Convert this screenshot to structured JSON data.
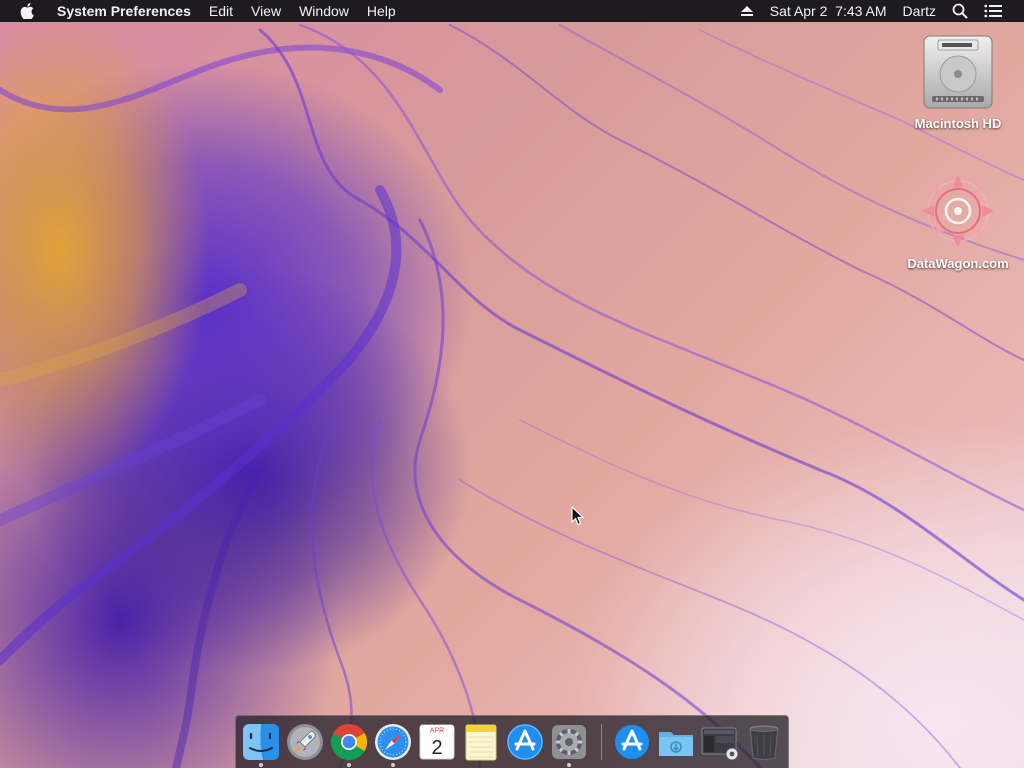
{
  "menubar": {
    "app_name": "System Preferences",
    "menus": [
      "Edit",
      "View",
      "Window",
      "Help"
    ],
    "clock": "Sat Apr 2  7:43 AM",
    "user": "Dartz"
  },
  "desktop": {
    "icons": [
      {
        "label": "Macintosh HD",
        "icon": "hard-drive-icon"
      },
      {
        "label": "DataWagon.com",
        "icon": "datawagon-disk-icon"
      }
    ]
  },
  "dock": {
    "items": [
      {
        "name": "Finder",
        "icon": "finder-icon",
        "running": true
      },
      {
        "name": "Launchpad",
        "icon": "launchpad-icon",
        "running": false
      },
      {
        "name": "Google Chrome",
        "icon": "chrome-icon",
        "running": true
      },
      {
        "name": "Safari",
        "icon": "safari-icon",
        "running": true
      },
      {
        "name": "Calendar",
        "icon": "calendar-icon",
        "running": false,
        "month": "APR",
        "day": "2"
      },
      {
        "name": "Notes",
        "icon": "notes-icon",
        "running": false
      },
      {
        "name": "App Store",
        "icon": "app-store-icon",
        "running": false
      },
      {
        "name": "System Preferences",
        "icon": "system-preferences-icon",
        "running": true
      },
      {
        "name": "Applications",
        "icon": "applications-folder-icon",
        "running": false
      },
      {
        "name": "Downloads",
        "icon": "downloads-folder-icon",
        "running": false
      },
      {
        "name": "Screenshots",
        "icon": "screenshots-stack-icon",
        "running": false
      },
      {
        "name": "Trash",
        "icon": "trash-icon",
        "running": false
      }
    ]
  },
  "colors": {
    "menubar_bg": "#1d1b20",
    "wallpaper_purple": "#5a2fc8",
    "wallpaper_pink": "#d98aa3",
    "wallpaper_gold": "#e3a23a"
  }
}
